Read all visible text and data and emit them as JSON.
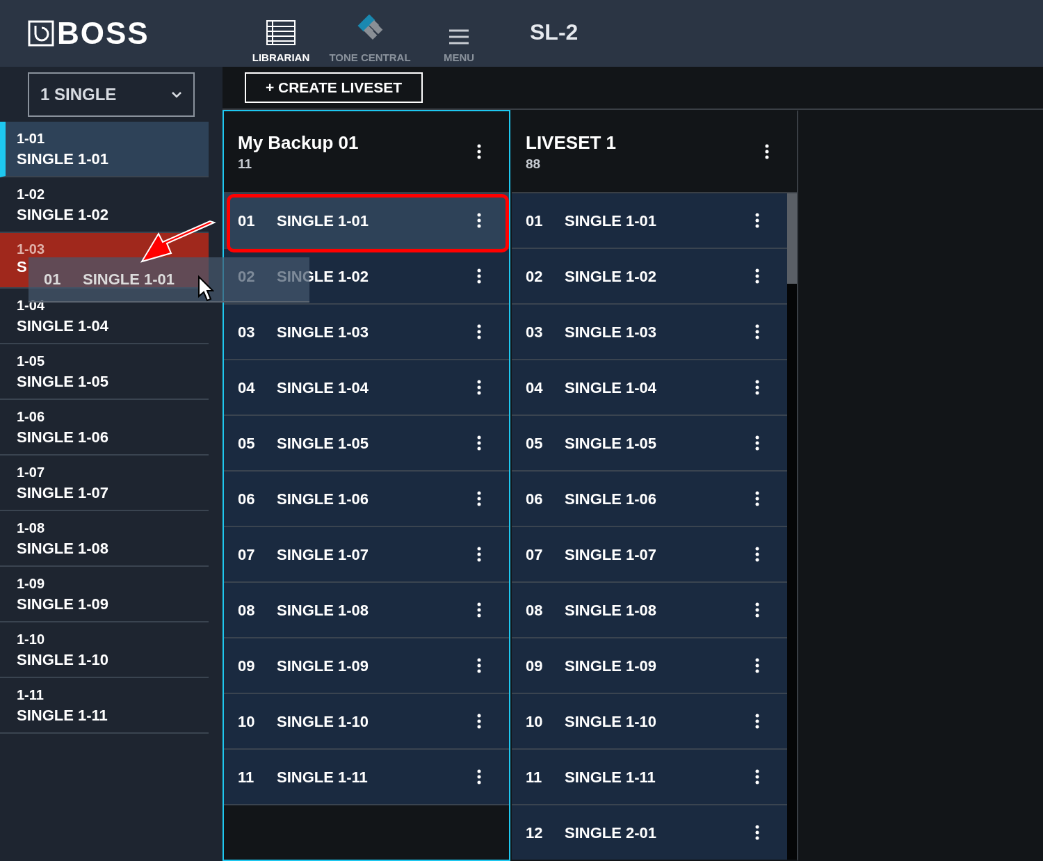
{
  "header": {
    "logo": "BOSS",
    "nav": [
      {
        "label": "LIBRARIAN",
        "kind": "list",
        "selected": true
      },
      {
        "label": "TONE CENTRAL",
        "kind": "diamond",
        "selected": false
      },
      {
        "label": "MENU",
        "kind": "menu",
        "selected": false
      }
    ],
    "device": "SL-2"
  },
  "sidebar": {
    "dropdown": "1 SINGLE",
    "items": [
      {
        "number": "1-01",
        "name": "SINGLE 1-01",
        "selected": true,
        "drop_target": false
      },
      {
        "number": "1-02",
        "name": "SINGLE 1-02",
        "selected": false,
        "drop_target": false
      },
      {
        "number": "1-03",
        "name": "S",
        "selected": false,
        "drop_target": true
      },
      {
        "number": "1-04",
        "name": "SINGLE 1-04",
        "selected": false,
        "drop_target": false
      },
      {
        "number": "1-05",
        "name": "SINGLE 1-05",
        "selected": false,
        "drop_target": false
      },
      {
        "number": "1-06",
        "name": "SINGLE 1-06",
        "selected": false,
        "drop_target": false
      },
      {
        "number": "1-07",
        "name": "SINGLE 1-07",
        "selected": false,
        "drop_target": false
      },
      {
        "number": "1-08",
        "name": "SINGLE 1-08",
        "selected": false,
        "drop_target": false
      },
      {
        "number": "1-09",
        "name": "SINGLE 1-09",
        "selected": false,
        "drop_target": false
      },
      {
        "number": "1-10",
        "name": "SINGLE 1-10",
        "selected": false,
        "drop_target": false
      },
      {
        "number": "1-11",
        "name": "SINGLE 1-11",
        "selected": false,
        "drop_target": false
      }
    ]
  },
  "create_button": "+ CREATE LIVESET",
  "livesets": [
    {
      "title": "My Backup 01",
      "count": "11",
      "active": true,
      "rows": [
        {
          "number": "01",
          "name": "SINGLE 1-01",
          "selected": true
        },
        {
          "number": "02",
          "name": "SINGLE 1-02",
          "selected": false
        },
        {
          "number": "03",
          "name": "SINGLE 1-03",
          "selected": false
        },
        {
          "number": "04",
          "name": "SINGLE 1-04",
          "selected": false
        },
        {
          "number": "05",
          "name": "SINGLE 1-05",
          "selected": false
        },
        {
          "number": "06",
          "name": "SINGLE 1-06",
          "selected": false
        },
        {
          "number": "07",
          "name": "SINGLE 1-07",
          "selected": false
        },
        {
          "number": "08",
          "name": "SINGLE 1-08",
          "selected": false
        },
        {
          "number": "09",
          "name": "SINGLE 1-09",
          "selected": false
        },
        {
          "number": "10",
          "name": "SINGLE 1-10",
          "selected": false
        },
        {
          "number": "11",
          "name": "SINGLE 1-11",
          "selected": false
        }
      ]
    },
    {
      "title": "LIVESET 1",
      "count": "88",
      "active": false,
      "rows": [
        {
          "number": "01",
          "name": "SINGLE 1-01",
          "selected": false
        },
        {
          "number": "02",
          "name": "SINGLE 1-02",
          "selected": false
        },
        {
          "number": "03",
          "name": "SINGLE 1-03",
          "selected": false
        },
        {
          "number": "04",
          "name": "SINGLE 1-04",
          "selected": false
        },
        {
          "number": "05",
          "name": "SINGLE 1-05",
          "selected": false
        },
        {
          "number": "06",
          "name": "SINGLE 1-06",
          "selected": false
        },
        {
          "number": "07",
          "name": "SINGLE 1-07",
          "selected": false
        },
        {
          "number": "08",
          "name": "SINGLE 1-08",
          "selected": false
        },
        {
          "number": "09",
          "name": "SINGLE 1-09",
          "selected": false
        },
        {
          "number": "10",
          "name": "SINGLE 1-10",
          "selected": false
        },
        {
          "number": "11",
          "name": "SINGLE 1-11",
          "selected": false
        },
        {
          "number": "12",
          "name": "SINGLE 2-01",
          "selected": false
        }
      ]
    }
  ],
  "drag_ghost": {
    "number": "01",
    "name": "SINGLE 1-01"
  }
}
